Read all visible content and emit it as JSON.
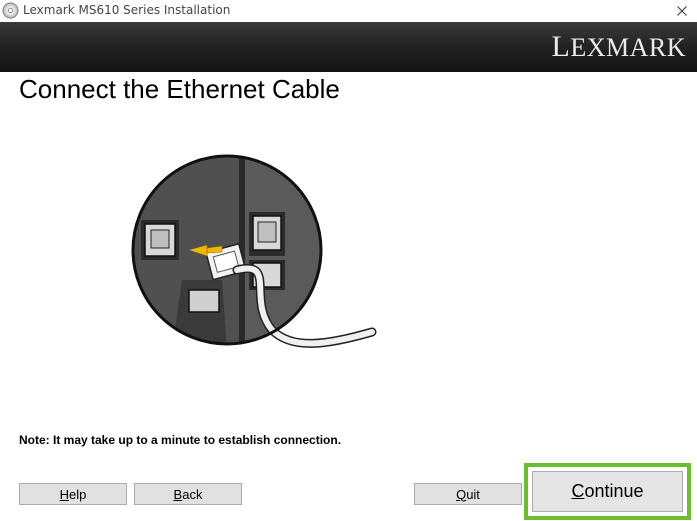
{
  "window": {
    "title": "Lexmark MS610 Series Installation",
    "app_icon": "disc-icon",
    "close_icon": "close-icon"
  },
  "banner": {
    "brand": "LEXMARK",
    "brand_first": "L",
    "brand_rest": "EXMARK",
    "background": "#1c1c1c"
  },
  "main": {
    "title": "Connect the Ethernet Cable",
    "illustration": "ethernet-cable-connection-illustration",
    "note": "Note: It may take up to a minute to establish connection."
  },
  "buttons": {
    "help": {
      "mnemonic": "H",
      "rest": "elp"
    },
    "back": {
      "mnemonic": "B",
      "rest": "ack"
    },
    "quit": {
      "mnemonic": "Q",
      "rest": "uit"
    },
    "continue": {
      "mnemonic": "C",
      "rest": "ontinue"
    }
  },
  "colors": {
    "continue_highlight": "#6abf2f",
    "arrow": "#f2b705",
    "button_face": "#e1e1e1"
  }
}
